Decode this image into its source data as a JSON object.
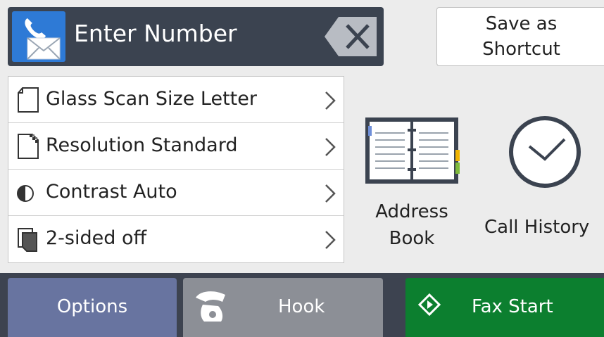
{
  "header": {
    "number_label": "Enter Number",
    "icons": {
      "fax": "fax-phone-envelope-icon",
      "backspace": "backspace-x-icon"
    }
  },
  "shortcut": {
    "label": "Save as\nShortcut"
  },
  "settings": {
    "items": [
      {
        "label": "Glass Scan Size Letter",
        "icon": "document-page-icon"
      },
      {
        "label": "Resolution Standard",
        "icon": "resolution-page-icon"
      },
      {
        "label": "Contrast Auto",
        "icon": "contrast-half-circle-icon"
      },
      {
        "label": "2-sided off",
        "icon": "two-sided-pages-icon"
      }
    ]
  },
  "tiles": {
    "address_book": {
      "label": "Address\nBook",
      "icon": "address-book-icon"
    },
    "call_history": {
      "label": "Call History",
      "icon": "clock-icon"
    }
  },
  "bottom": {
    "options_label": "Options",
    "hook_label": "Hook",
    "fax_start_label": "Fax Start"
  },
  "colors": {
    "header_bg": "#3b4350",
    "options_bg": "#6874a0",
    "hook_bg": "#8c8f96",
    "fax_start_bg": "#0c7f2f",
    "bottom_bar": "#3d4350",
    "accent_blue": "#2b6fd1"
  }
}
